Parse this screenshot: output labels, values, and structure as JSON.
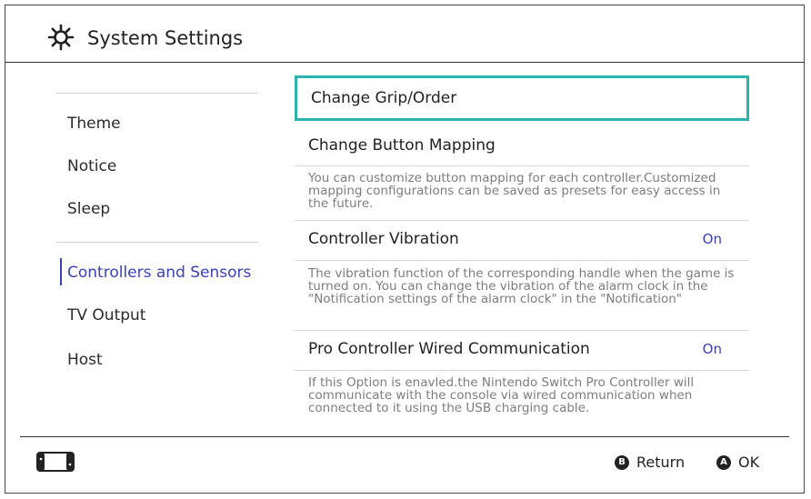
{
  "header": {
    "title": "System Settings",
    "icon": "gear-icon"
  },
  "sidebar": {
    "items": [
      {
        "label": "Theme"
      },
      {
        "label": "Notice"
      },
      {
        "label": "Sleep"
      },
      {
        "label": "Controllers and Sensors",
        "active": true
      },
      {
        "label": "TV Output"
      },
      {
        "label": "Host"
      }
    ]
  },
  "main": {
    "rows": [
      {
        "label": "Change Grip/Order",
        "selected": true
      },
      {
        "label": "Change Button Mapping",
        "desc": "You can customize button mapping for each controller.Customized mapping configurations can be saved as presets for easy access in the future."
      },
      {
        "label": "Controller Vibration",
        "value": "On",
        "desc": "The vibration function of the corresponding handle when the game is turned on. You can change the vibration of the alarm clock in the \"Notification settings of the alarm clock\" in the \"Notification\""
      },
      {
        "label": "Pro Controller Wired Communication",
        "value": "On",
        "desc": "If this Option is enavled.the Nintendo Switch Pro Controller will communicate with the console via wired communication when connected to it using the USB charging cable."
      }
    ]
  },
  "footer": {
    "return_button": {
      "glyph": "B",
      "label": "Return"
    },
    "ok_button": {
      "glyph": "A",
      "label": "OK"
    },
    "console_icon": "console-icon"
  },
  "colors": {
    "accent": "#3b3fb6",
    "selection": "#2bb3b0"
  }
}
